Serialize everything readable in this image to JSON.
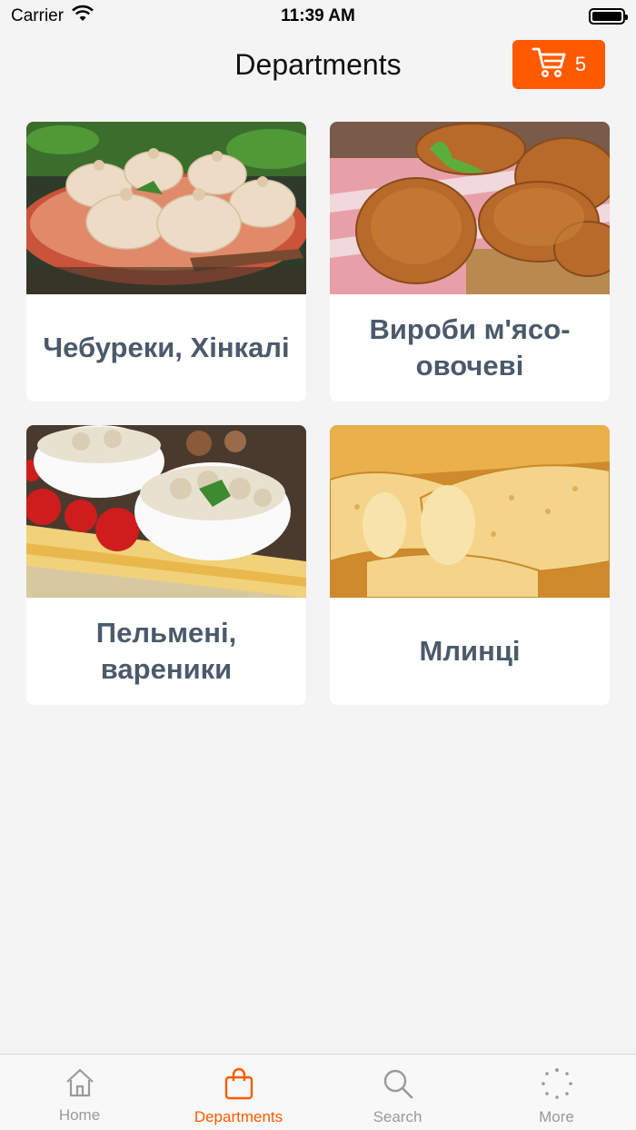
{
  "status_bar": {
    "carrier": "Carrier",
    "time": "11:39 AM"
  },
  "header": {
    "title": "Departments",
    "cart_count": "5"
  },
  "departments": [
    {
      "label": "Чебуреки, Хінкалі",
      "image": "khinkali-photo"
    },
    {
      "label": "Вироби м'ясо-овочеві",
      "image": "cutlets-photo"
    },
    {
      "label": "Пельмені, вареники",
      "image": "dumplings-photo"
    },
    {
      "label": "Млинці",
      "image": "pancakes-photo"
    }
  ],
  "tab_bar": {
    "items": [
      {
        "label": "Home",
        "icon": "home-icon"
      },
      {
        "label": "Departments",
        "icon": "shopping-bag-icon"
      },
      {
        "label": "Search",
        "icon": "search-icon"
      },
      {
        "label": "More",
        "icon": "more-dots-icon"
      }
    ],
    "active_index": 1
  },
  "colors": {
    "accent": "#ff5a00",
    "label_text": "#4b5a6b",
    "background": "#f4f4f4"
  }
}
